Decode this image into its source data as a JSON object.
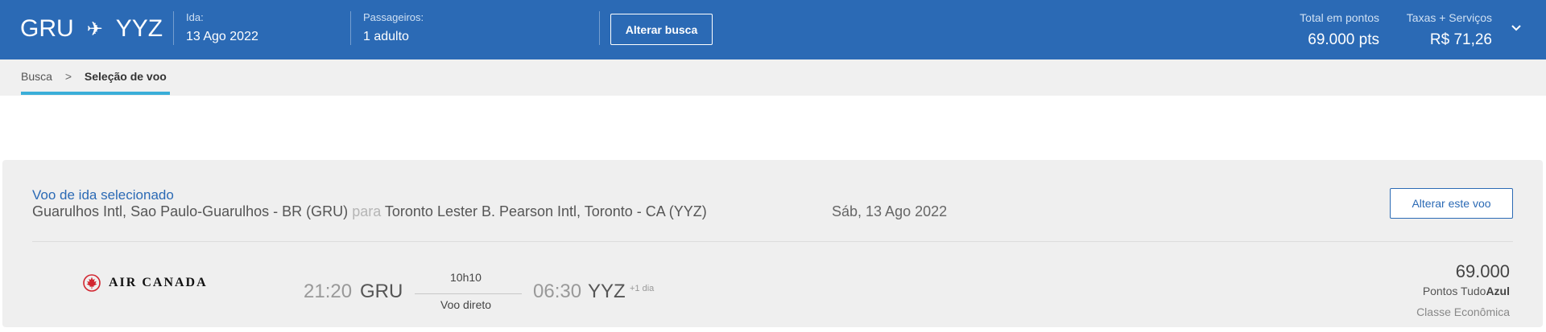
{
  "header": {
    "origin": "GRU",
    "destination": "YYZ",
    "depart_label": "Ida:",
    "depart_value": "13 Ago 2022",
    "passengers_label": "Passageiros:",
    "passengers_value": "1 adulto",
    "change_search_label": "Alterar busca",
    "total_points_label": "Total em pontos",
    "total_points_value": "69.000 pts",
    "fees_label": "Taxas + Serviços",
    "fees_value": "R$ 71,26"
  },
  "breadcrumb": {
    "items": [
      "Busca",
      "Seleção de voo"
    ],
    "separator": ">"
  },
  "selected_flight": {
    "title": "Voo de ida selecionado",
    "origin_airport": "Guarulhos Intl, Sao Paulo-Guarulhos - BR (GRU)",
    "connector": "para",
    "destination_airport": "Toronto Lester B. Pearson Intl, Toronto - CA (YYZ)",
    "date": "Sáb, 13 Ago 2022",
    "change_flight_label": "Alterar este voo",
    "airline": "AIR CANADA",
    "departure_time": "21:20",
    "departure_code": "GRU",
    "duration": "10h10",
    "stops": "Voo direto",
    "arrival_time": "06:30",
    "arrival_code": "YYZ",
    "day_offset": "+1 dia",
    "points": "69.000",
    "points_unit_prefix": "Pontos Tudo",
    "points_unit_brand": "Azul",
    "cabin": "Classe Econômica"
  },
  "colors": {
    "header_bg": "#2b6ab5",
    "accent_blue": "#2b6ab5",
    "breadcrumb_underline": "#3aaed8",
    "card_bg": "#efefef",
    "air_canada_red": "#d22630"
  },
  "icons": {
    "plane": "airplane-icon",
    "expand": "chevron-down-icon",
    "airline_logo": "maple-leaf-logo"
  }
}
